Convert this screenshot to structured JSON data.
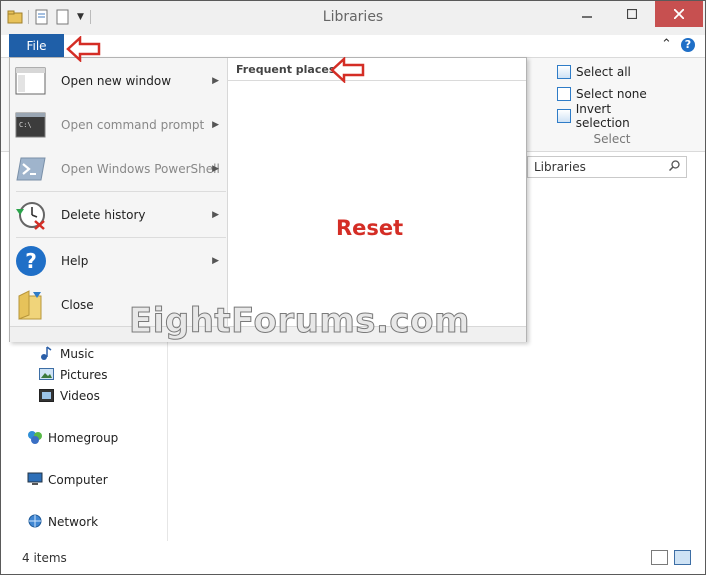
{
  "window": {
    "title": "Libraries"
  },
  "file_tab": {
    "label": "File"
  },
  "file_menu": {
    "items": [
      {
        "label": "Open new window",
        "icon": "window-icon",
        "enabled": true,
        "submenu": true
      },
      {
        "label": "Open command prompt",
        "icon": "command-prompt-icon",
        "enabled": false,
        "submenu": true
      },
      {
        "label": "Open Windows PowerShell",
        "icon": "powershell-icon",
        "enabled": false,
        "submenu": true
      },
      {
        "label": "Delete history",
        "icon": "delete-history-icon",
        "enabled": true,
        "submenu": true
      },
      {
        "label": "Help",
        "icon": "help-icon",
        "enabled": true,
        "submenu": true
      },
      {
        "label": "Close",
        "icon": "close-folder-icon",
        "enabled": true,
        "submenu": false
      }
    ],
    "frequent_places_header": "Frequent places"
  },
  "annotation": {
    "reset_label": "Reset",
    "arrow_color": "#d42d25"
  },
  "ribbon": {
    "select_group": {
      "items": [
        "Select all",
        "Select none",
        "Invert selection"
      ],
      "group_label": "Select"
    }
  },
  "address": {
    "path": "Libraries"
  },
  "nav_pane": {
    "items": [
      {
        "label": "Music",
        "icon": "music-icon"
      },
      {
        "label": "Pictures",
        "icon": "pictures-icon"
      },
      {
        "label": "Videos",
        "icon": "videos-icon"
      },
      {
        "label": "Homegroup",
        "icon": "homegroup-icon"
      },
      {
        "label": "Computer",
        "icon": "computer-icon"
      },
      {
        "label": "Network",
        "icon": "network-icon"
      }
    ]
  },
  "status_bar": {
    "count": "4 items"
  },
  "watermark": {
    "text": "EightForums.com"
  },
  "colors": {
    "file_tab": "#1f5fa8",
    "close_button": "#c75050",
    "accent": "#2f7cc7"
  }
}
